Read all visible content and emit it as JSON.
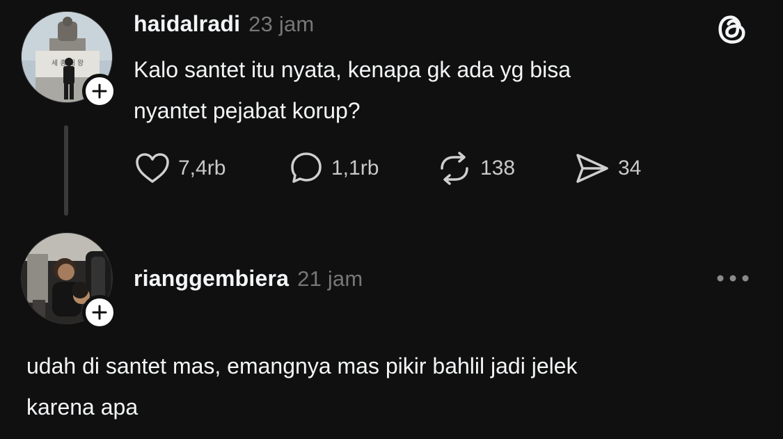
{
  "post": {
    "username": "haidalradi",
    "time": "23 jam",
    "text_line1": "Kalo santet itu nyata, kenapa gk ada yg bisa",
    "text_line2": "nyantet pejabat korup?",
    "likes": "7,4rb",
    "replies": "1,1rb",
    "reposts": "138",
    "shares": "34"
  },
  "reply": {
    "username": "rianggembiera",
    "time": "21 jam",
    "text_line1": "udah di santet mas, emangnya mas pikir bahlil jadi jelek",
    "text_line2": "karena apa"
  },
  "icons": {
    "logo": "threads-logo-icon",
    "like": "heart-icon",
    "reply": "comment-bubble-icon",
    "repost": "repost-icon",
    "share": "send-icon",
    "follow": "plus-icon",
    "more": "more-dots-icon"
  },
  "colors": {
    "background": "#101010",
    "text": "#f3f5f7",
    "muted": "#777777"
  },
  "avatar_statue_text": "세 종 대 왕"
}
